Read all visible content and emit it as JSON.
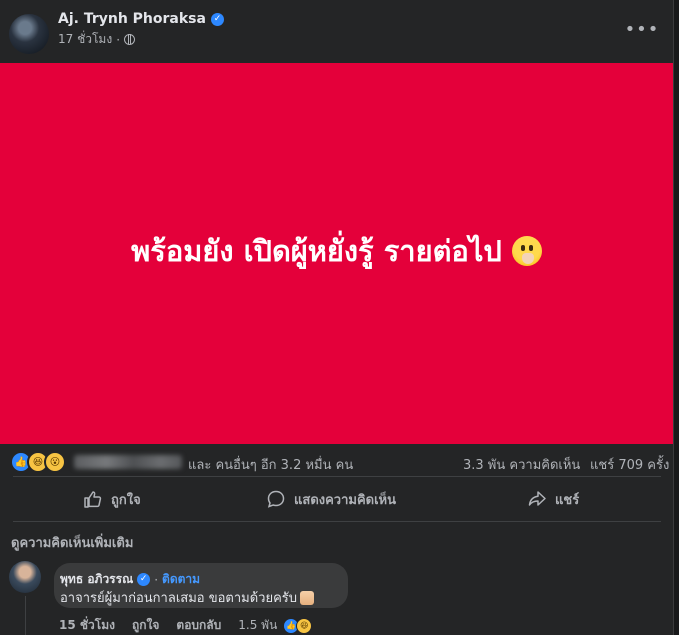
{
  "post": {
    "author": "Aj. Trynh Phoraksa",
    "time": "17 ชั่วโมง",
    "time_separator": "·",
    "image_text": "พร้อมยัง เปิดผู้หยั่งรู้ รายต่อไป"
  },
  "stats": {
    "reactors": "และ คนอื่นๆ อีก 3.2 หมื่น คน",
    "comments": "3.3 พัน ความคิดเห็น",
    "shares": "แชร์ 709 ครั้ง"
  },
  "actions": {
    "like": "ถูกใจ",
    "comment": "แสดงความคิดเห็น",
    "share": "แชร์"
  },
  "comments_section": {
    "more_comments": "ดูความคิดเห็นเพิ่มเติม",
    "items": [
      {
        "name": "พุทธ อภิวรรณ",
        "separator": "·",
        "follow": "ติดตาม",
        "text": "อาจารย์ผู้มาก่อนกาลเสมอ ขอตามด้วยครับ",
        "time": "15 ชั่วโมง",
        "like": "ถูกใจ",
        "reply": "ตอบกลับ",
        "reaction_count": "1.5 พัน"
      }
    ]
  },
  "colors": {
    "post_background": "#e4003a",
    "card": "#242526",
    "accent": "#2d88ff"
  }
}
